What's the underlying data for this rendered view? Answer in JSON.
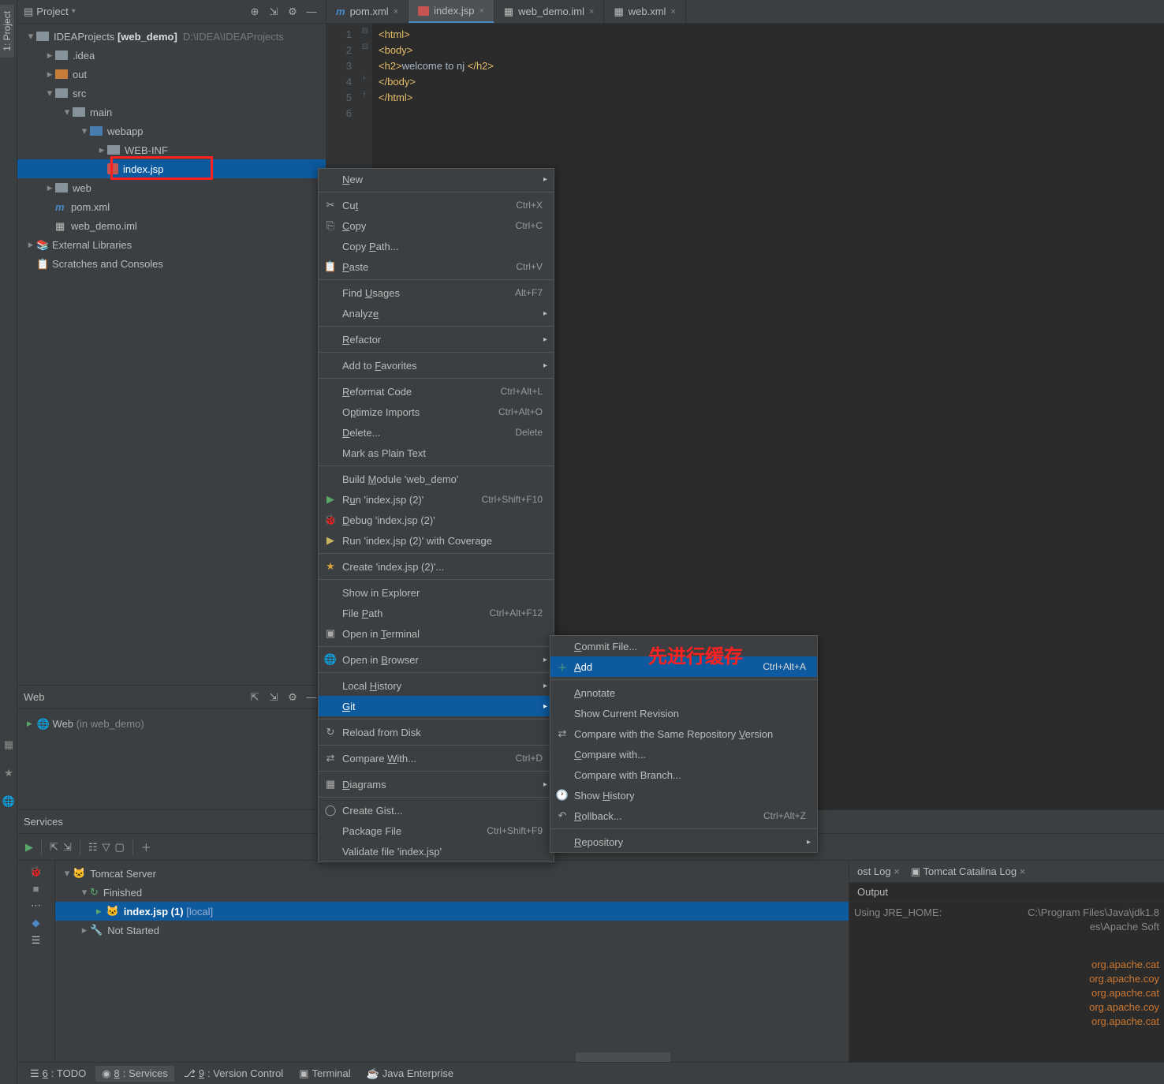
{
  "sidebar": {
    "vtabs": [
      "1: Project"
    ],
    "bottom_vtabs": [
      "7: Structure",
      "2: Favorites",
      "Web"
    ]
  },
  "project": {
    "header": "Project",
    "root": {
      "name": "IDEAProjects",
      "bold": "[web_demo]",
      "path": "D:\\IDEA\\IDEAProjects"
    },
    "tree": {
      "idea": ".idea",
      "out": "out",
      "src": "src",
      "main": "main",
      "webapp": "webapp",
      "webinf": "WEB-INF",
      "indexjsp": "index.jsp",
      "web": "web",
      "pom": "pom.xml",
      "iml": "web_demo.iml",
      "extlib": "External Libraries",
      "scratch": "Scratches and Consoles"
    }
  },
  "tabs": [
    {
      "name": "pom.xml",
      "icon": "m"
    },
    {
      "name": "index.jsp",
      "icon": "jsp",
      "active": true
    },
    {
      "name": "web_demo.iml",
      "icon": "iml"
    },
    {
      "name": "web.xml",
      "icon": "xml"
    }
  ],
  "editor": {
    "lines": [
      {
        "n": 1,
        "html": "<html>"
      },
      {
        "n": 2,
        "html": "<body>"
      },
      {
        "n": 3,
        "pre": "<h2>",
        "txt": "welcome to nj ",
        "post": "</h2>"
      },
      {
        "n": 4,
        "html": "</body>"
      },
      {
        "n": 5,
        "html": "</html>"
      },
      {
        "n": 6,
        "html": ""
      }
    ]
  },
  "web_panel": {
    "header": "Web",
    "row": {
      "label": "Web",
      "suffix": "(in web_demo)"
    }
  },
  "services": {
    "header": "Services",
    "tree": {
      "tomcat": "Tomcat Server",
      "finished": "Finished",
      "run_item": "index.jsp (1)",
      "run_suffix": "[local]",
      "not_started": "Not Started"
    },
    "output_tabs": {
      "tab1_suffix": "ost Log",
      "tab2": "Tomcat Catalina Log"
    },
    "output_header": "Output",
    "output_lines": [
      {
        "left": "Using  JRE_HOME:",
        "right": "C:\\Program Files\\Java\\jdk1.8"
      },
      {
        "left": "",
        "right": "es\\Apache Soft"
      },
      {
        "left": "",
        "right": "org.apache.cat"
      },
      {
        "left": "",
        "right": "org.apache.coy"
      },
      {
        "left": "",
        "right": "org.apache.cat"
      },
      {
        "left": "",
        "right": "org.apache.coy"
      },
      {
        "left": "",
        "right": "org.apache.cat"
      }
    ]
  },
  "context_menu_main": [
    {
      "label": "New",
      "arrow": true,
      "u": 0
    },
    {
      "sep": true
    },
    {
      "label": "Cut",
      "shortcut": "Ctrl+X",
      "icon": "✂",
      "u": 2
    },
    {
      "label": "Copy",
      "shortcut": "Ctrl+C",
      "icon": "⎘",
      "u": 0
    },
    {
      "label": "Copy Path...",
      "u": 5
    },
    {
      "label": "Paste",
      "shortcut": "Ctrl+V",
      "icon": "📋",
      "u": 0
    },
    {
      "sep": true
    },
    {
      "label": "Find Usages",
      "shortcut": "Alt+F7",
      "u": 5
    },
    {
      "label": "Analyze",
      "arrow": true,
      "u": 6
    },
    {
      "sep": true
    },
    {
      "label": "Refactor",
      "arrow": true,
      "u": 0
    },
    {
      "sep": true
    },
    {
      "label": "Add to Favorites",
      "arrow": true,
      "u": 7
    },
    {
      "sep": true
    },
    {
      "label": "Reformat Code",
      "shortcut": "Ctrl+Alt+L",
      "u": 0
    },
    {
      "label": "Optimize Imports",
      "shortcut": "Ctrl+Alt+O",
      "u": 1
    },
    {
      "label": "Delete...",
      "shortcut": "Delete",
      "u": 0
    },
    {
      "label": "Mark as Plain Text"
    },
    {
      "sep": true
    },
    {
      "label": "Build Module 'web_demo'",
      "u": 6
    },
    {
      "label": "Run 'index.jsp (2)'",
      "shortcut": "Ctrl+Shift+F10",
      "icon": "▶",
      "icon_color": "#59a869",
      "u": 1
    },
    {
      "label": "Debug 'index.jsp (2)'",
      "icon": "🐞",
      "icon_color": "#59a869",
      "u": 0
    },
    {
      "label": "Run 'index.jsp (2)' with Coverage",
      "icon": "▶",
      "icon_color": "#c9b35f"
    },
    {
      "sep": true
    },
    {
      "label": "Create 'index.jsp (2)'...",
      "icon": "★",
      "icon_color": "#d6a23e"
    },
    {
      "sep": true
    },
    {
      "label": "Show in Explorer"
    },
    {
      "label": "File Path",
      "shortcut": "Ctrl+Alt+F12",
      "u": 5
    },
    {
      "label": "Open in Terminal",
      "icon": "▣",
      "u": 8
    },
    {
      "sep": true
    },
    {
      "label": "Open in Browser",
      "arrow": true,
      "icon": "🌐",
      "u": 8
    },
    {
      "sep": true
    },
    {
      "label": "Local History",
      "arrow": true,
      "u": 6
    },
    {
      "label": "Git",
      "arrow": true,
      "selected": true,
      "u": 0
    },
    {
      "sep": true
    },
    {
      "label": "Reload from Disk",
      "icon": "↻"
    },
    {
      "sep": true
    },
    {
      "label": "Compare With...",
      "shortcut": "Ctrl+D",
      "icon": "⇄",
      "u": 8
    },
    {
      "sep": true
    },
    {
      "label": "Diagrams",
      "arrow": true,
      "icon": "▦",
      "u": 0
    },
    {
      "sep": true
    },
    {
      "label": "Create Gist...",
      "icon": "◯"
    },
    {
      "label": "Package File",
      "shortcut": "Ctrl+Shift+F9"
    },
    {
      "label": "Validate file 'index.jsp'"
    }
  ],
  "context_menu_git": [
    {
      "label": "Commit File...",
      "u": 0
    },
    {
      "label": "Add",
      "shortcut": "Ctrl+Alt+A",
      "icon": "＋",
      "icon_color": "#59a869",
      "selected": true,
      "u": 0
    },
    {
      "sep": true
    },
    {
      "label": "Annotate",
      "u": 0
    },
    {
      "label": "Show Current Revision"
    },
    {
      "label": "Compare with the Same Repository Version",
      "icon": "⇄",
      "u": 33
    },
    {
      "label": "Compare with...",
      "u": 0
    },
    {
      "label": "Compare with Branch..."
    },
    {
      "label": "Show History",
      "icon": "🕐",
      "u": 5
    },
    {
      "label": "Rollback...",
      "shortcut": "Ctrl+Alt+Z",
      "icon": "↶",
      "u": 0
    },
    {
      "sep": true
    },
    {
      "label": "Repository",
      "arrow": true,
      "u": 0
    }
  ],
  "bottom_tabs": [
    {
      "label": "6: TODO",
      "icon": "☰"
    },
    {
      "label": "8: Services",
      "icon": "◉",
      "active": true
    },
    {
      "label": "9: Version Control",
      "icon": "⎇"
    },
    {
      "label": "Terminal",
      "icon": "▣"
    },
    {
      "label": "Java Enterprise",
      "icon": "☕"
    }
  ],
  "annotation_text": "先进行缓存"
}
